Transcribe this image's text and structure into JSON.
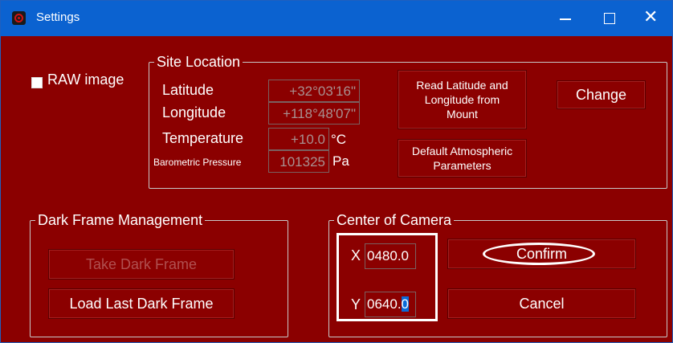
{
  "window": {
    "title": "Settings"
  },
  "raw_image": {
    "label": "RAW image",
    "checked": false
  },
  "site_location": {
    "legend": "Site Location",
    "latitude_label": "Latitude",
    "latitude_value": "+32°03'16\"",
    "longitude_label": "Longitude",
    "longitude_value": "+118°48'07\"",
    "temperature_label": "Temperature",
    "temperature_value": "+10.0",
    "temperature_unit": "°C",
    "pressure_label": "Barometric Pressure",
    "pressure_value": "101325",
    "pressure_unit": "Pa",
    "read_button_line1": "Read Latitude and",
    "read_button_line2": "Longitude from",
    "read_button_line3": "Mount",
    "change_button": "Change",
    "default_button_line1": "Default Atmospheric",
    "default_button_line2": "Parameters"
  },
  "dark_frame": {
    "legend": "Dark Frame Management",
    "take_button": "Take Dark Frame",
    "load_button": "Load Last Dark Frame"
  },
  "center_camera": {
    "legend": "Center of Camera",
    "x_label": "X",
    "x_value": "0480.0",
    "y_label": "Y",
    "y_value_unselected": "0640.",
    "y_value_selected": "0",
    "confirm_button": "Confirm",
    "cancel_button": "Cancel"
  },
  "colors": {
    "background": "#8b0000",
    "titlebar": "#0b62d0",
    "selection": "#0a6ad8"
  }
}
